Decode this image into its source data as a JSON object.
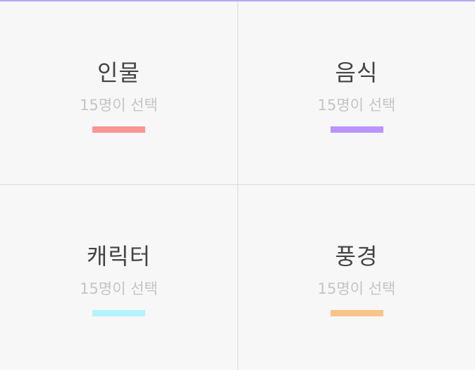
{
  "categories": [
    {
      "title": "인물",
      "subtitle": "15명이 선택",
      "color": "#ff9494"
    },
    {
      "title": "음식",
      "subtitle": "15명이 선택",
      "color": "#bb94ff"
    },
    {
      "title": "캐릭터",
      "subtitle": "15명이 선택",
      "color": "#b3f4fa"
    },
    {
      "title": "풍경",
      "subtitle": "15명이 선택",
      "color": "#f9c489"
    }
  ]
}
